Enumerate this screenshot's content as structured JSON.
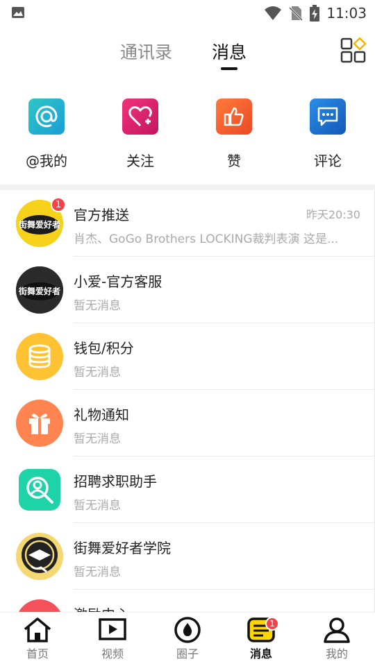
{
  "status_bar": {
    "time": "11:03"
  },
  "tabs": {
    "contacts": "通讯录",
    "messages": "消息"
  },
  "quick_actions": [
    {
      "label": "@我的",
      "icon": "at-icon",
      "color": "#1fb5c9"
    },
    {
      "label": "关注",
      "icon": "heart-plus-icon",
      "color": "#e0266a"
    },
    {
      "label": "赞",
      "icon": "thumbs-up-icon",
      "color": "#f2582f"
    },
    {
      "label": "评论",
      "icon": "comment-icon",
      "color": "#1a6fd0"
    }
  ],
  "messages": [
    {
      "title": "官方推送",
      "subtitle": "肖杰、GoGo Brothers LOCKING裁判表演 这是...",
      "time": "昨天20:30",
      "badge": "1",
      "avatar": "street-dance-logo"
    },
    {
      "title": "小爱-官方客服",
      "subtitle": "暂无消息",
      "avatar": "street-dance-logo-dark"
    },
    {
      "title": "钱包/积分",
      "subtitle": "暂无消息",
      "avatar": "coins-icon"
    },
    {
      "title": "礼物通知",
      "subtitle": "暂无消息",
      "avatar": "gift-icon"
    },
    {
      "title": "招聘求职助手",
      "subtitle": "暂无消息",
      "avatar": "recruit-search-icon"
    },
    {
      "title": "街舞爱好者学院",
      "subtitle": "暂无消息",
      "avatar": "academy-logo"
    },
    {
      "title": "激励中心",
      "subtitle": "",
      "avatar": "incentive-icon"
    }
  ],
  "bottom_nav": [
    {
      "label": "首页",
      "icon": "home-icon"
    },
    {
      "label": "视频",
      "icon": "video-icon"
    },
    {
      "label": "圈子",
      "icon": "circle-drop-icon"
    },
    {
      "label": "消息",
      "icon": "message-icon",
      "badge": "1",
      "active": true
    },
    {
      "label": "我的",
      "icon": "profile-icon"
    }
  ],
  "colors": {
    "accent": "#ffd400",
    "badge": "#f4414a"
  }
}
